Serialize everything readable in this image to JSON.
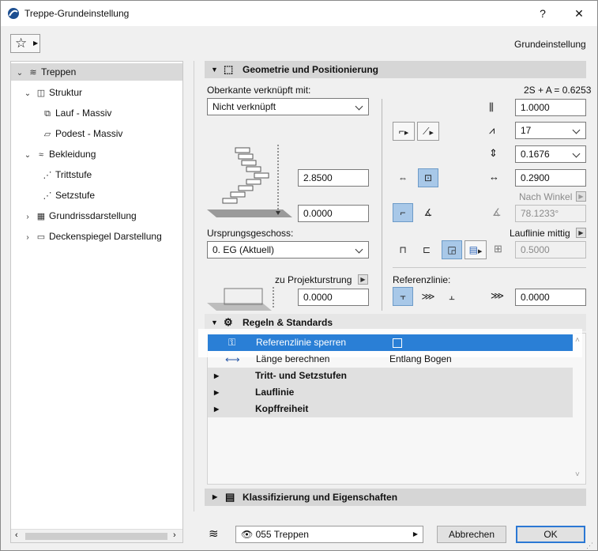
{
  "window": {
    "title": "Treppe-Grundeinstellung",
    "help": "?",
    "close": "✕"
  },
  "header": {
    "mode_label": "Grundeinstellung"
  },
  "tree": {
    "items": [
      {
        "label": "Treppen"
      },
      {
        "label": "Struktur"
      },
      {
        "label": "Lauf - Massiv"
      },
      {
        "label": "Podest - Massiv"
      },
      {
        "label": "Bekleidung"
      },
      {
        "label": "Trittstufe"
      },
      {
        "label": "Setzstufe"
      },
      {
        "label": "Grundrissdarstellung"
      },
      {
        "label": "Deckenspiegel Darstellung"
      }
    ]
  },
  "geometry": {
    "title": "Geometrie und Positionierung",
    "top_linked_label": "Oberkante verknüpft mit:",
    "top_linked_value": "Nicht verknüpft",
    "height_value": "2.8500",
    "offset_value": "0.0000",
    "origin_story_label": "Ursprungsgeschoss:",
    "origin_story_value": "0. EG (Aktuell)",
    "project_origin_label": "zu Projekturstrung",
    "project_origin_value": "0.0000",
    "formula": "2S + A = 0.6253",
    "width_value": "1.0000",
    "risers_value": "17",
    "riser_height_value": "0.1676",
    "tread_depth_value": "0.2900",
    "by_angle_label": "Nach Winkel",
    "angle_value": "78.1233°",
    "walkline_label": "Lauflinie mittig",
    "walkline_value": "0.5000",
    "reference_line_label": "Referenzlinie:",
    "reference_offset_value": "0.0000"
  },
  "rules": {
    "title": "Regeln & Standards",
    "rows": [
      {
        "label": "Referenzlinie sperren",
        "value": ""
      },
      {
        "label": "Länge berechnen",
        "value": "Entlang Bogen"
      }
    ],
    "groups": [
      {
        "label": "Tritt- und Setzstufen"
      },
      {
        "label": "Lauflinie"
      },
      {
        "label": "Kopffreiheit"
      }
    ]
  },
  "classification": {
    "title": "Klassifizierung und Eigenschaften"
  },
  "footer": {
    "layer_value": "055 Treppen",
    "cancel_label": "Abbrechen",
    "ok_label": "OK"
  }
}
